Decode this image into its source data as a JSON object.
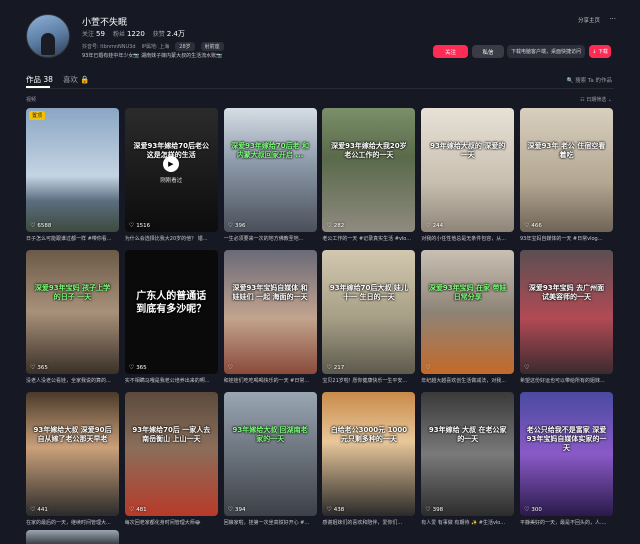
{
  "profile": {
    "name": "小萱不失眠",
    "follow_label": "关注",
    "follow_count": "59",
    "fans_label": "粉丝",
    "fans_count": "1220",
    "likes_label": "获赞",
    "likes_count": "2.4万",
    "account_id": "抖音号: ltbnmnNNU3d",
    "ip": "IP属地: 上海",
    "age_tag": "28岁",
    "extra_tag": "射箭座",
    "bio": "93年已婚有娃中年少女📷 湖南妹子嫁内蒙大叔的生活流水账📷"
  },
  "header_actions": {
    "share": "分享主页",
    "more": "···",
    "follow_btn": "关注",
    "message_btn": "私信",
    "download": "下载电脑客户端，桌面快捷访问",
    "download_btn": "↓ 下载"
  },
  "tabs": [
    {
      "label": "作品 38"
    },
    {
      "label": "喜欢 🔒"
    }
  ],
  "search_label": "🔍 搜索 Ta 的作品",
  "section_label": "视频",
  "sort_label": "☷ 日期筛选 ⌄",
  "videos": [
    {
      "overlay": "",
      "likes": "6588",
      "pinned": "置顶",
      "caption": "日子怎么可能跟谁过都一样 #带你看..."
    },
    {
      "overlay": "深爱93年嫁给70后老公 这是怎样的生活",
      "likes": "1516",
      "play": "▶",
      "replay": "刚刚看过",
      "caption": "为什么会选择比我大20岁的他？ 婚..."
    },
    {
      "overlay": "深爱93年嫁给70后老 和内蒙大叔回家开启 ...",
      "likes": "396",
      "caption": "一生必须要来一次的地方佛教圣地..."
    },
    {
      "overlay": "深爱93年嫁给大我20岁 老公工作的一天",
      "likes": "282",
      "caption": "老公工作的一天 #记录真实生活 #vlo..."
    },
    {
      "overlay": "93年嫁给大叔的 深爱的一天",
      "likes": "244",
      "caption": "对我的小任性他总是无条件包容，从..."
    },
    {
      "overlay": "深爱93年 老公 住宿空看着吃",
      "likes": "466",
      "caption": "93年宝妈自媒体的一天 #日常vlog..."
    },
    {
      "overlay": "深爱93年宝妈 孩子上学的日子 一天",
      "likes": "365",
      "caption": "没老人没老公看娃，全家我说的算的..."
    },
    {
      "overlay": "广东人的普通话 到底有多沙呢？",
      "big": true,
      "likes": "365",
      "caption": "实不相瞒马哦是我老公培养出来的啊..."
    },
    {
      "overlay": "深爱93年宝妈自媒体 和娃娃们 一起 海面的一天",
      "likes": "",
      "caption": "和娃娃们吃吃喝喝快乐的一天 #日常..."
    },
    {
      "overlay": "93年嫁给70后大叔 娃儿十一 生日的一天",
      "likes": "217",
      "caption": "宝贝21岁啦! 愿你健康快乐一生平安..."
    },
    {
      "overlay": "深爱93年宝妈 在家 带娃 日常分享",
      "likes": "",
      "caption": "年纪越大越喜欢创生活做减法，对我..."
    },
    {
      "overlay": "深爱93年宝妈 去广州面试美容师的一天",
      "likes": "",
      "caption": "希望这份好运也可以带给所有的姐妹..."
    },
    {
      "overlay": "93年嫁给大叔 深爱90后 自从嫁了老公那天早老",
      "likes": "441",
      "caption": "在家的最后的一天，继续时间管理大..."
    },
    {
      "overlay": "93年嫁给70后 一家人去南岳衡山 上山一天",
      "likes": "481",
      "caption": "每次回老家都化身时间管理大师😂"
    },
    {
      "overlay": "93年嫁给大叔 回湖南老家的一天",
      "likes": "394",
      "caption": "回娘家啦，挂第一次坐高铁好开心 #..."
    },
    {
      "overlay": "白给老公3000元 1000元只剩多种的一天",
      "likes": "438",
      "caption": "感谢姐妹们的喜欢和陪伴，爱你们..."
    },
    {
      "overlay": "93年嫁给 大叔 在老公家 的一天",
      "likes": "398",
      "caption": "有人爱 有事做 有期待 ✨ #生活vlo..."
    },
    {
      "overlay": "老公只给我不是富家 深爱93年宝妈自媒体实家的一天",
      "likes": "300",
      "caption": "平静美好的一天，最是不回头的，人...."
    }
  ]
}
